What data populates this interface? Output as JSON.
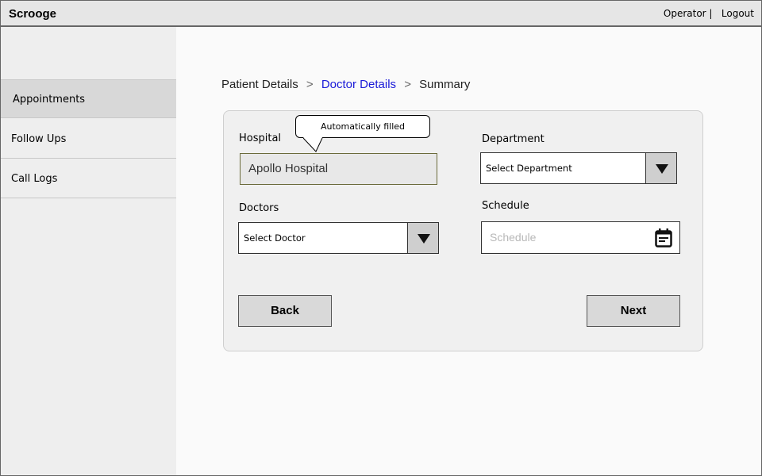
{
  "app": {
    "title": "Scrooge"
  },
  "topnav": {
    "operator": "Operator |",
    "logout": "Logout"
  },
  "sidebar": {
    "items": [
      {
        "label": "Appointments"
      },
      {
        "label": "Follow Ups"
      },
      {
        "label": "Call Logs"
      }
    ]
  },
  "breadcrumb": {
    "step1": "Patient Details",
    "step2": "Doctor Details",
    "step3": "Summary",
    "separator": ">"
  },
  "form": {
    "hospital_label": "Hospital",
    "hospital_value": "Apollo Hospital",
    "tooltip": "Automatically filled",
    "department_label": "Department",
    "department_value": "Select Department",
    "doctors_label": "Doctors",
    "doctors_value": "Select Doctor",
    "schedule_label": "Schedule",
    "schedule_placeholder": "Schedule",
    "back_label": "Back",
    "next_label": "Next"
  },
  "icons": {
    "calendar": "calendar-icon",
    "dropdown": "triangle-down-icon"
  },
  "colors": {
    "link": "#1a1ad8",
    "sidebar_active": "#d8d8d8"
  }
}
